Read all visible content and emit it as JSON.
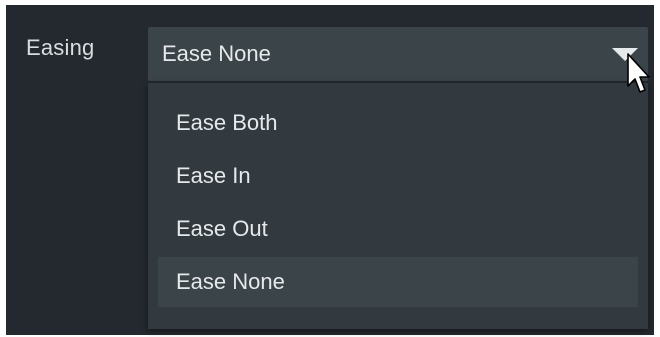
{
  "easing": {
    "label": "Easing",
    "selected_value": "Ease None",
    "options": [
      {
        "label": "Ease Both",
        "selected": false
      },
      {
        "label": "Ease In",
        "selected": false
      },
      {
        "label": "Ease Out",
        "selected": false
      },
      {
        "label": "Ease None",
        "selected": true
      }
    ]
  },
  "colors": {
    "panel_background": "#23292e",
    "select_background": "#3b4449",
    "dropdown_background": "#323a3f",
    "text": "#e6e9eb"
  },
  "icons": {
    "caret": "caret-down-icon",
    "cursor": "mouse-pointer-icon"
  }
}
